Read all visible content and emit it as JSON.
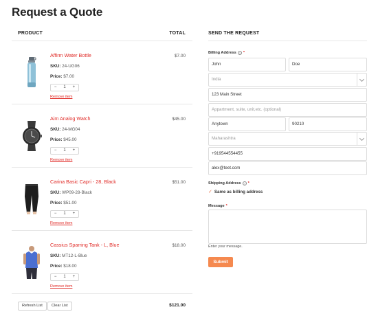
{
  "page": {
    "title": "Request a Quote"
  },
  "cart": {
    "col_product": "PRODUCT",
    "col_total": "TOTAL",
    "items": [
      {
        "name": "Affirm Water Bottle",
        "sku_label": "SKU:",
        "sku": "24-UG06",
        "price_label": "Price:",
        "price": "$7.00",
        "qty": "1",
        "minus": "−",
        "plus": "+",
        "remove": "Remove item",
        "total": "$7.00",
        "image": "water-bottle"
      },
      {
        "name": "Aim Analog Watch",
        "sku_label": "SKU:",
        "sku": "24-MG04",
        "price_label": "Price:",
        "price": "$45.00",
        "qty": "1",
        "minus": "−",
        "plus": "+",
        "remove": "Remove item",
        "total": "$45.00",
        "image": "analog-watch"
      },
      {
        "name": "Carina Basic Capri - 28, Black",
        "sku_label": "SKU:",
        "sku": "WP09-28-Black",
        "price_label": "Price:",
        "price": "$51.00",
        "qty": "1",
        "minus": "−",
        "plus": "+",
        "remove": "Remove item",
        "total": "$51.00",
        "image": "black-capri"
      },
      {
        "name": "Cassius Sparring Tank - L, Blue",
        "sku_label": "SKU:",
        "sku": "MT12-L-Blue",
        "price_label": "Price:",
        "price": "$18.00",
        "qty": "1",
        "minus": "−",
        "plus": "+",
        "remove": "Remove item",
        "total": "$18.00",
        "image": "blue-tank"
      }
    ],
    "refresh_label": "Refresh List",
    "clear_label": "Clear List",
    "grand_total": "$121.00"
  },
  "request": {
    "heading": "SEND THE REQUEST",
    "billing_label": "Billing Address",
    "help_glyph": "?",
    "required_mark": "*",
    "first_name": "John",
    "last_name": "Doe",
    "country": "India",
    "street": "123 Main Street",
    "street2_placeholder": "Appartment, suite, unit,etc. (optional)",
    "city": "Anytown",
    "postcode": "90210",
    "state": "Maharashtra",
    "phone": "+919544554455",
    "email": "alex@teet.com",
    "shipping_label": "Shipping Address",
    "same_as_billing": "Same as billing address",
    "check_glyph": "✓",
    "message_label": "Message",
    "message_hint": "Enter your message.",
    "submit_label": "Submit"
  },
  "colors": {
    "accent": "#e02b27",
    "submit": "#f5894f",
    "border": "#dcdcdc"
  }
}
